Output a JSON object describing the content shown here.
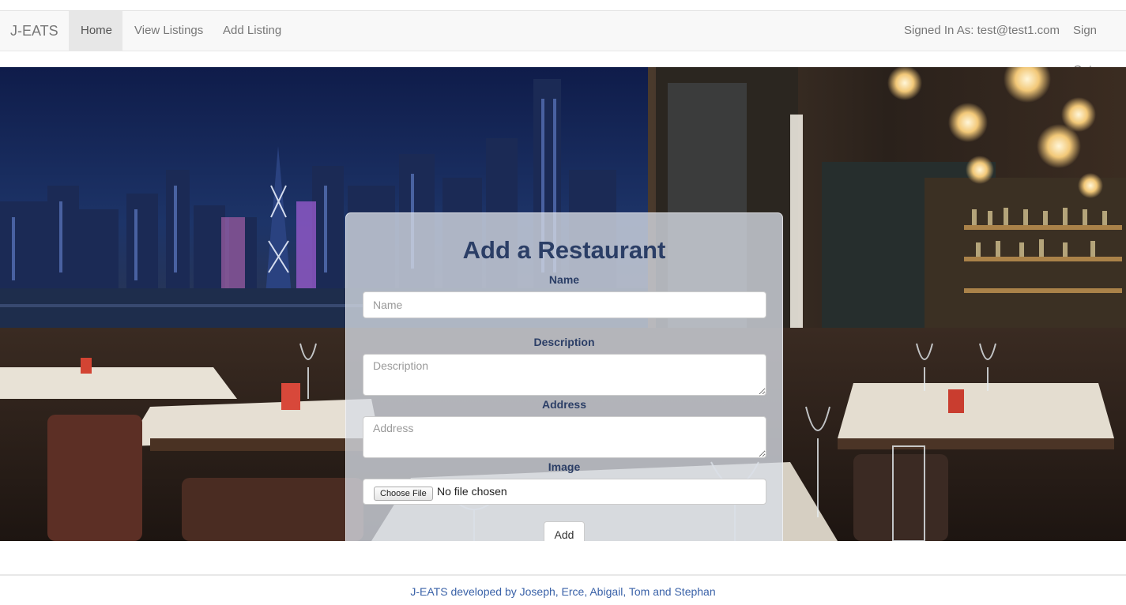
{
  "nav": {
    "brand": "J-EATS",
    "items": [
      {
        "label": "Home",
        "active": true
      },
      {
        "label": "View Listings",
        "active": false
      },
      {
        "label": "Add Listing",
        "active": false
      }
    ],
    "signed_in": "Signed In As: test@test1.com",
    "sign_out": "Sign Out"
  },
  "form": {
    "title": "Add a Restaurant",
    "name_label": "Name",
    "name_placeholder": "Name",
    "description_label": "Description",
    "description_placeholder": "Description",
    "address_label": "Address",
    "address_placeholder": "Address",
    "image_label": "Image",
    "file_button": "Choose File",
    "file_status": "No file chosen",
    "submit": "Add"
  },
  "footer": {
    "text": "J-EATS developed by Joseph, Erce, Abigail, Tom and Stephan"
  },
  "colors": {
    "title": "#2b3e66",
    "footer_link": "#3a62a8",
    "navbar_bg": "#f8f8f8"
  }
}
